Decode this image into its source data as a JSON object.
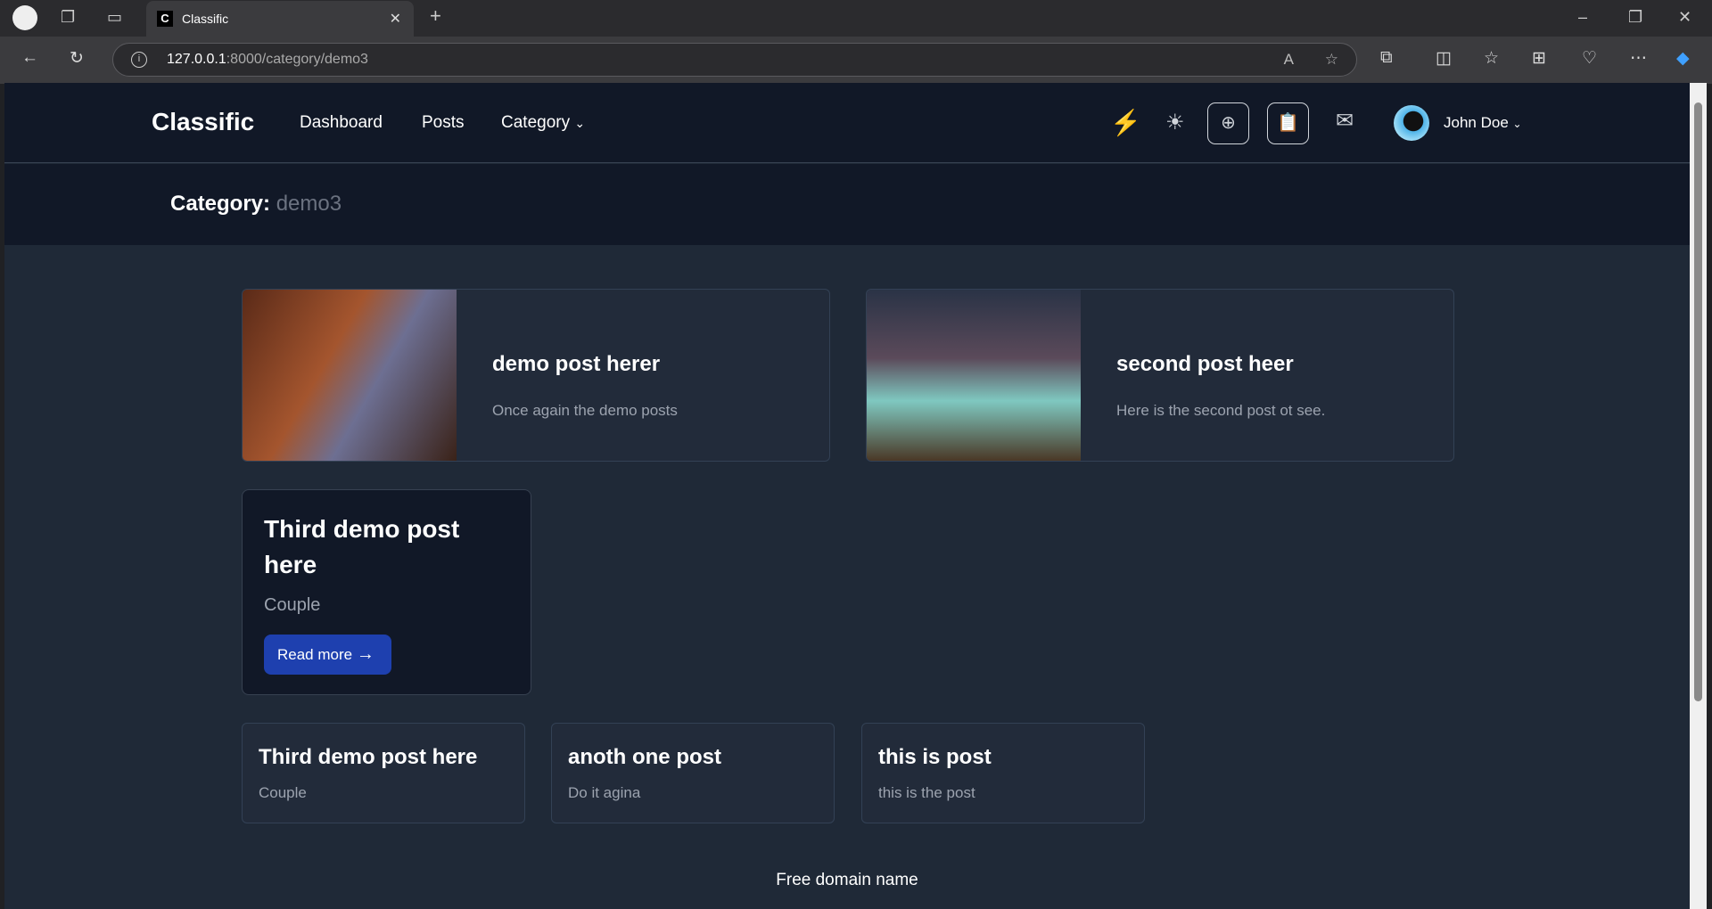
{
  "browser": {
    "tab_title": "Classific",
    "favicon": "C",
    "url_host": "127.0.0.1",
    "url_path": ":8000/category/demo3"
  },
  "nav": {
    "logo": "Classific",
    "links": [
      "Dashboard",
      "Posts",
      "Category"
    ],
    "user": "John Doe"
  },
  "header": {
    "label": "Category:",
    "value": "demo3"
  },
  "posts": [
    {
      "title": "demo post herer",
      "desc": "Once again the demo posts"
    },
    {
      "title": "second post heer",
      "desc": "Here is the second post ot see."
    }
  ],
  "featured": {
    "title": "Third demo post here",
    "desc": "Couple",
    "button": "Read more"
  },
  "small_posts": [
    {
      "title": "Third demo post here",
      "desc": "Couple"
    },
    {
      "title": "anoth one post",
      "desc": "Do it agina"
    },
    {
      "title": "this is post",
      "desc": "this is the post"
    }
  ],
  "footer": "Free domain name",
  "colors": {
    "accent": "#1e40af",
    "nav_bg": "#111827",
    "page_bg": "#1f2937",
    "bolt": "#f5a623"
  }
}
